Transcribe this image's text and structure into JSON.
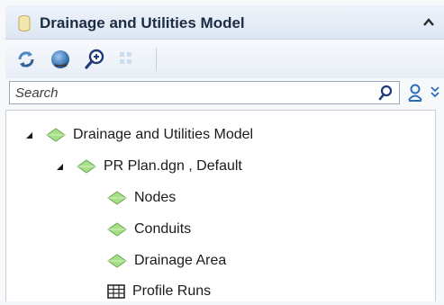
{
  "panel": {
    "title": "Drainage and Utilities Model",
    "collapse_icon": "chevron-up-icon"
  },
  "toolbar": {
    "buttons": [
      {
        "name": "refresh-icon"
      },
      {
        "name": "globe-icon"
      },
      {
        "name": "zoom-in-icon"
      },
      {
        "name": "grid-icon"
      }
    ]
  },
  "search": {
    "placeholder": "Search",
    "value": ""
  },
  "tree": {
    "root": {
      "label": "Drainage and Utilities Model",
      "expanded": true
    },
    "file": {
      "label": "PR Plan.dgn , Default",
      "expanded": true
    },
    "items": [
      {
        "label": "Nodes",
        "icon": "gem-icon"
      },
      {
        "label": "Conduits",
        "icon": "gem-icon"
      },
      {
        "label": "Drainage Area",
        "icon": "gem-icon"
      },
      {
        "label": "Profile Runs",
        "icon": "table-icon"
      }
    ]
  },
  "colors": {
    "gem_fill": "#a8e08a",
    "gem_stroke": "#6aa84f",
    "title_text": "#1c2c44",
    "accent_blue": "#2a6ebb"
  }
}
